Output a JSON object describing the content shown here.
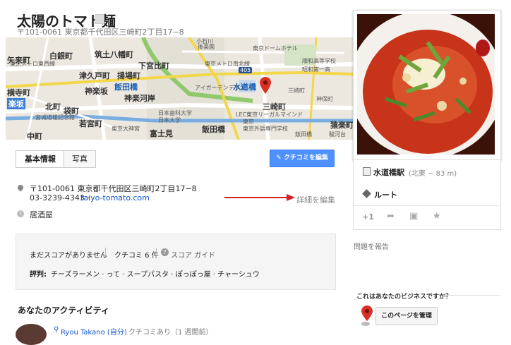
{
  "header": {
    "title": "太陽のトマト麺",
    "address": "〒101-0061 東京都千代田区三崎町2丁目17−8"
  },
  "map": {
    "labels": [
      "矢来町",
      "白銀町",
      "筑土八幡町",
      "下宮比町",
      "横寺町",
      "津久戸町",
      "揚場町",
      "楽坂",
      "神楽坂",
      "飯田橋",
      "神楽河岸",
      "北町",
      "袋町",
      "水道橋",
      "三崎町",
      "若宮町",
      "中町",
      "富士見",
      "飯田橋",
      "宮城道雄記念館",
      "東京ドームホテル",
      "後楽園",
      "小石川",
      "順和高等学校",
      "昭和第一高",
      "東京メトロ南北線",
      "東京メトロ東西線",
      "日本歯科大学",
      "日本大学",
      "東京大神宮",
      "アイガーデンテラス",
      "LEC東京リーガルマインド",
      "東京",
      "東京外語専門学校",
      "三崎町",
      "神保町",
      "猿楽町",
      "駿河台",
      "飯田橋"
    ],
    "route_badge": "405"
  },
  "tabs": {
    "basic": "基本情報",
    "photos": "写真"
  },
  "edit_review_button": "クチコミを編集",
  "details": {
    "address": "〒101-0061 東京都千代田区三崎町2丁目17−8",
    "phone": "03-3239-4343",
    "separator": "·",
    "website": "taiyo-tomato.com",
    "edit_details": "詳細を編集",
    "category": "居酒屋"
  },
  "review_box": {
    "no_score": "まだスコアがありません",
    "review_count": "クチコミ 6 件",
    "score_guide": "スコア ガイド",
    "reputation_label": "評判:",
    "reputation_text": "チーズラーメン · って · スープパスタ · ぽっぽっ屋 · チャーシュウ"
  },
  "activity": {
    "title": "あなたのアクティビティ",
    "user_name": "Ryou Takano (自分)",
    "user_meta": "クチコミあり（1 週間前）"
  },
  "right_panel": {
    "station_name": "水道橋駅",
    "station_dist": "(北東 ~ 83 m)",
    "route_label": "ルート",
    "plus_one": "+1"
  },
  "report_link": "問題を報告",
  "business": {
    "question": "これはあなたのビジネスですか？",
    "manage_button": "このページを管理"
  },
  "colors": {
    "accent": "#4d90fe",
    "link": "#1155cc",
    "map_bg": "#ece8df",
    "pin": "#d93025"
  }
}
